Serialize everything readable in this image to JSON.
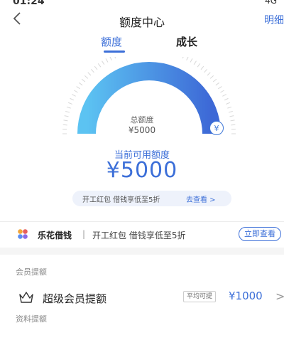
{
  "status": {
    "time": "01:24",
    "right": "4G"
  },
  "nav": {
    "back_icon": "chevron-left-icon",
    "title": "额度中心",
    "detail_label": "明细"
  },
  "tabs": [
    {
      "label": "额度",
      "active": true
    },
    {
      "label": "成长",
      "active": false
    }
  ],
  "gauge": {
    "total_label": "总额度",
    "total_value": "¥5000",
    "badge_symbol": "¥",
    "colors": {
      "start": "#5cc3f2",
      "end": "#3d68d6"
    }
  },
  "available": {
    "label": "当前可用额度",
    "amount": "¥5000"
  },
  "promo": {
    "text": "开工红包 借钱享低至5折",
    "link": "去查看 >"
  },
  "lehua": {
    "brand": "乐花借钱",
    "separator": "|",
    "text": "开工红包 借钱享低至5折",
    "button": "立即查看"
  },
  "sections": {
    "member_title": "会员提额",
    "vip_label": "超级会员提额",
    "vip_badge": "平均可提",
    "vip_amount": "¥1000",
    "vip_chevron": ">",
    "data_title": "资料提额"
  },
  "accent_color": "#3c6fd8"
}
